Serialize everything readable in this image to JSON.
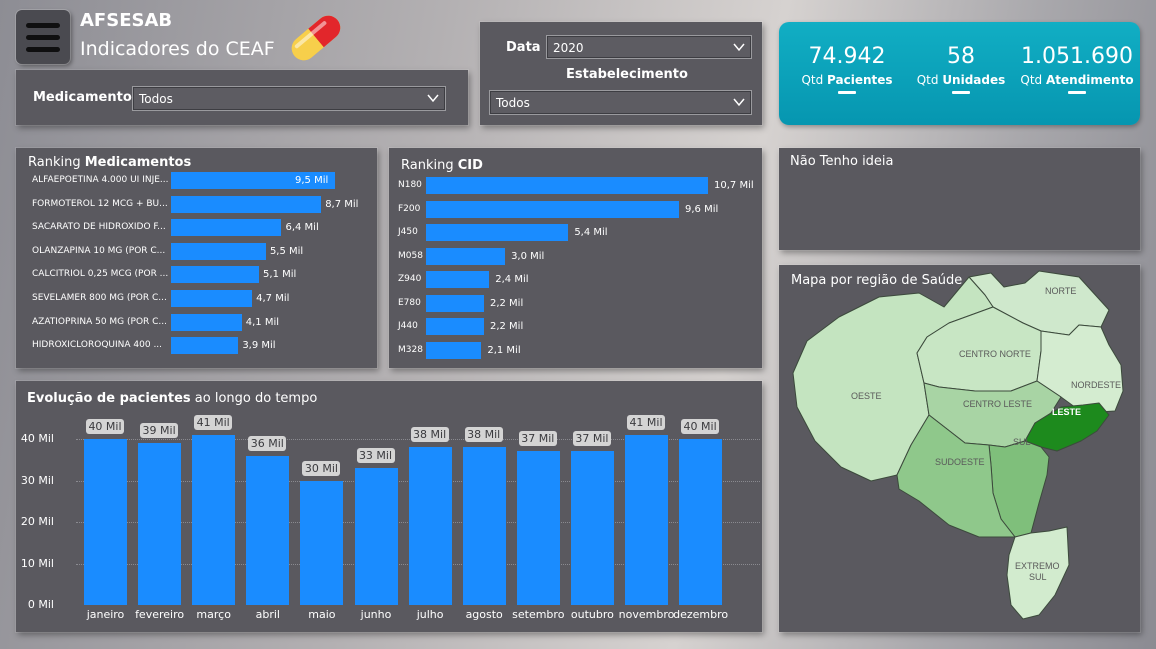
{
  "header": {
    "title": "AFSESAB",
    "subtitle": "Indicadores do CEAF",
    "icons": {
      "menu": "hamburger-icon",
      "logo": "pill-capsule-icon"
    }
  },
  "filters": {
    "medicamento_label": "Medicamento",
    "medicamento_value": "Todos",
    "data_label": "Data",
    "data_value": "2020",
    "estabelecimento_label": "Estabelecimento",
    "estabelecimento_value": "Todos"
  },
  "kpis": [
    {
      "value": "74.942",
      "pre": "Qtd ",
      "bold": "Pacientes"
    },
    {
      "value": "58",
      "pre": "Qtd ",
      "bold": "Unidades"
    },
    {
      "value": "1.051.690",
      "pre": "Qtd ",
      "bold": "Atendimento"
    }
  ],
  "ranking_med": {
    "title_pre": "Ranking ",
    "title_bold": "Medicamentos",
    "items": [
      {
        "label": "ALFAEPOETINA 4.000 UI INJE...",
        "value": 9.5,
        "text": "9,5 Mil"
      },
      {
        "label": "FORMOTEROL 12 MCG + BU...",
        "value": 8.7,
        "text": "8,7 Mil"
      },
      {
        "label": "SACARATO DE HIDROXIDO F...",
        "value": 6.4,
        "text": "6,4 Mil"
      },
      {
        "label": "OLANZAPINA 10 MG (POR C...",
        "value": 5.5,
        "text": "5,5 Mil"
      },
      {
        "label": "CALCITRIOL 0,25 MCG (POR ...",
        "value": 5.1,
        "text": "5,1 Mil"
      },
      {
        "label": "SEVELAMER 800 MG (POR C...",
        "value": 4.7,
        "text": "4,7 Mil"
      },
      {
        "label": "AZATIOPRINA 50 MG (POR C...",
        "value": 4.1,
        "text": "4,1 Mil"
      },
      {
        "label": "HIDROXICLOROQUINA 400 ...",
        "value": 3.9,
        "text": "3,9 Mil"
      }
    ]
  },
  "ranking_cid": {
    "title_pre": "Ranking ",
    "title_bold": "CID",
    "items": [
      {
        "label": "N180",
        "value": 10.7,
        "text": "10,7 Mil"
      },
      {
        "label": "F200",
        "value": 9.6,
        "text": "9,6 Mil"
      },
      {
        "label": "J450",
        "value": 5.4,
        "text": "5,4 Mil"
      },
      {
        "label": "M058",
        "value": 3.0,
        "text": "3,0 Mil"
      },
      {
        "label": "Z940",
        "value": 2.4,
        "text": "2,4 Mil"
      },
      {
        "label": "E780",
        "value": 2.2,
        "text": "2,2 Mil"
      },
      {
        "label": "J440",
        "value": 2.2,
        "text": "2,2 Mil"
      },
      {
        "label": "M328",
        "value": 2.1,
        "text": "2,1 Mil"
      }
    ]
  },
  "placeholder_panel": {
    "title": "Não Tenho ideia"
  },
  "map": {
    "title": "Mapa por região de Saúde",
    "regions": [
      "NORTE",
      "CENTRO NORTE",
      "NORDESTE",
      "OESTE",
      "CENTRO LESTE",
      "LESTE",
      "SUL",
      "SUDOESTE",
      "EXTREMO",
      "SUL"
    ]
  },
  "chart_data": {
    "type": "bar",
    "title_bold": "Evolução de pacientes",
    "title_rest": " ao longo do tempo",
    "categories": [
      "janeiro",
      "fevereiro",
      "março",
      "abril",
      "maio",
      "junho",
      "julho",
      "agosto",
      "setembro",
      "outubro",
      "novembro",
      "dezembro"
    ],
    "values": [
      40,
      39,
      41,
      36,
      30,
      33,
      38,
      38,
      37,
      37,
      41,
      40
    ],
    "labels": [
      "40 Mil",
      "39 Mil",
      "41 Mil",
      "36 Mil",
      "30 Mil",
      "33 Mil",
      "38 Mil",
      "38 Mil",
      "37 Mil",
      "37 Mil",
      "41 Mil",
      "40 Mil"
    ],
    "yticks": [
      "0 Mil",
      "10 Mil",
      "20 Mil",
      "30 Mil",
      "40 Mil"
    ],
    "ylim": [
      0,
      40
    ],
    "grid": true,
    "bar_color": "#1a8cff"
  }
}
